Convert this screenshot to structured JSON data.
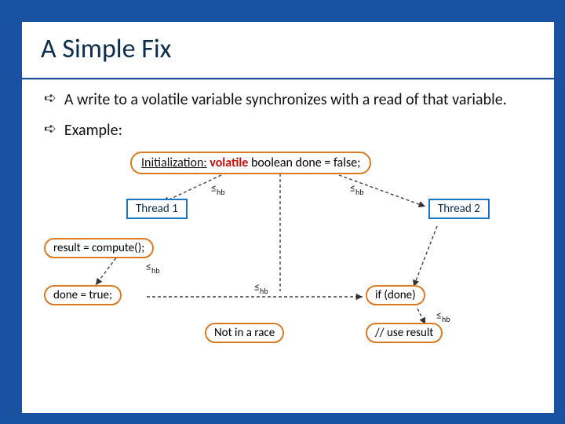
{
  "title": "A Simple Fix",
  "bullets": [
    "A write to a volatile variable synchronizes with a read of that variable.",
    "Example:"
  ],
  "init": {
    "label": "Initialization:",
    "volatile": "volatile",
    "rest": "boolean done = false;"
  },
  "threads": {
    "t1": "Thread 1",
    "t2": "Thread 2"
  },
  "nodes": {
    "compute": "result = compute();",
    "doneTrue": "done = true;",
    "ifDone": "if (done)",
    "useResult": "// use result",
    "notRace": "Not in a race"
  },
  "hb": "≤",
  "hbsub": "hb"
}
